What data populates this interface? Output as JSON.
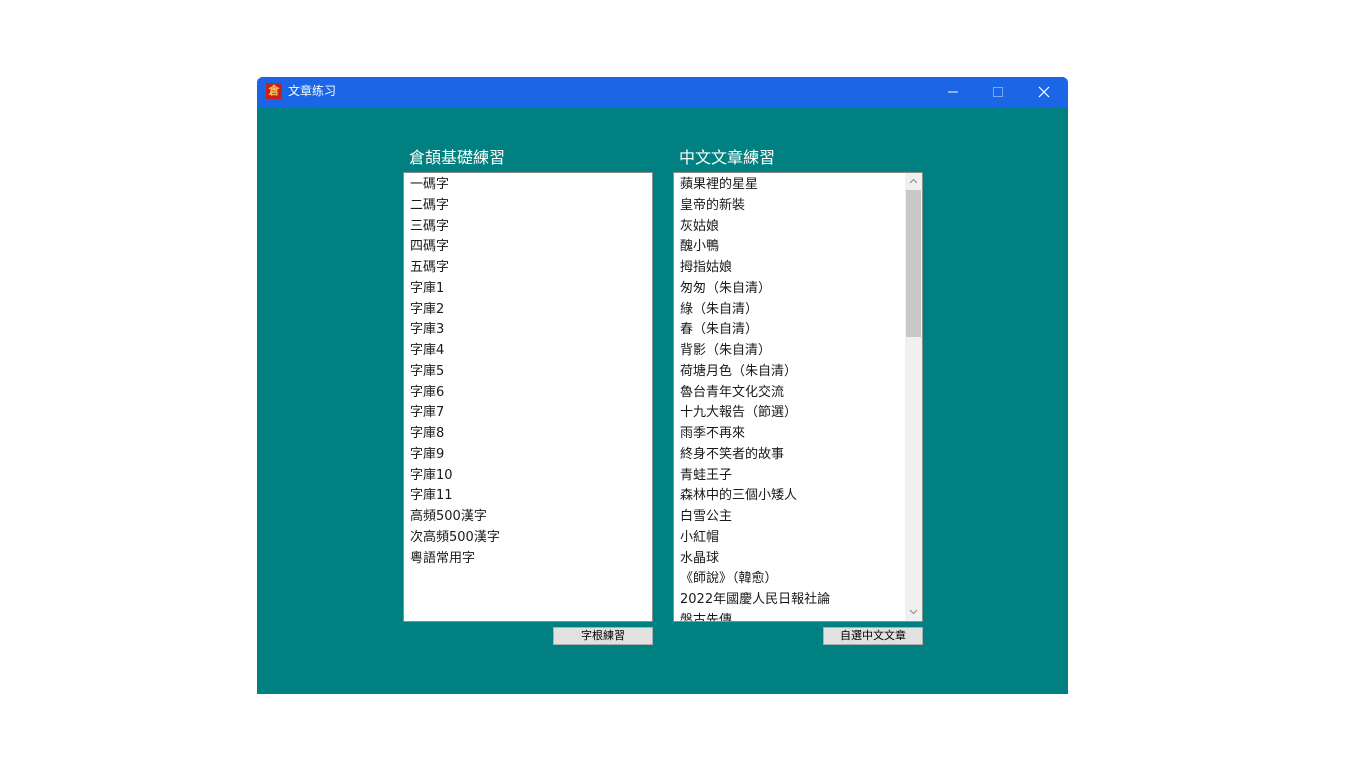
{
  "window": {
    "title": "文章练习",
    "icon_glyph": "倉",
    "titlebar_color": "#1a66e6",
    "background_color": "#008080"
  },
  "left_panel": {
    "title": "倉頡基礎練習",
    "items": [
      "一碼字",
      "二碼字",
      "三碼字",
      "四碼字",
      "五碼字",
      "字庫1",
      "字庫2",
      "字庫3",
      "字庫4",
      "字庫5",
      "字庫6",
      "字庫7",
      "字庫8",
      "字庫9",
      "字庫10",
      "字庫11",
      "高頻500漢字",
      "次高頻500漢字",
      "粵語常用字"
    ],
    "button_label": "字根練習"
  },
  "right_panel": {
    "title": "中文文章練習",
    "items": [
      "蘋果裡的星星",
      "皇帝的新裝",
      "灰姑娘",
      "醜小鴨",
      "拇指姑娘",
      "匆匆（朱自清）",
      "綠（朱自清）",
      "春（朱自清）",
      "背影（朱自清）",
      "荷塘月色（朱自清）",
      "魯台青年文化交流",
      "十九大報告（節選）",
      "雨季不再來",
      "終身不笑者的故事",
      "青蛙王子",
      "森林中的三個小矮人",
      "白雪公主",
      "小紅帽",
      "水晶球",
      "《師說》（韓愈）",
      "2022年國慶人民日報社論",
      "盤古先傳"
    ],
    "button_label": "自選中文文章"
  }
}
